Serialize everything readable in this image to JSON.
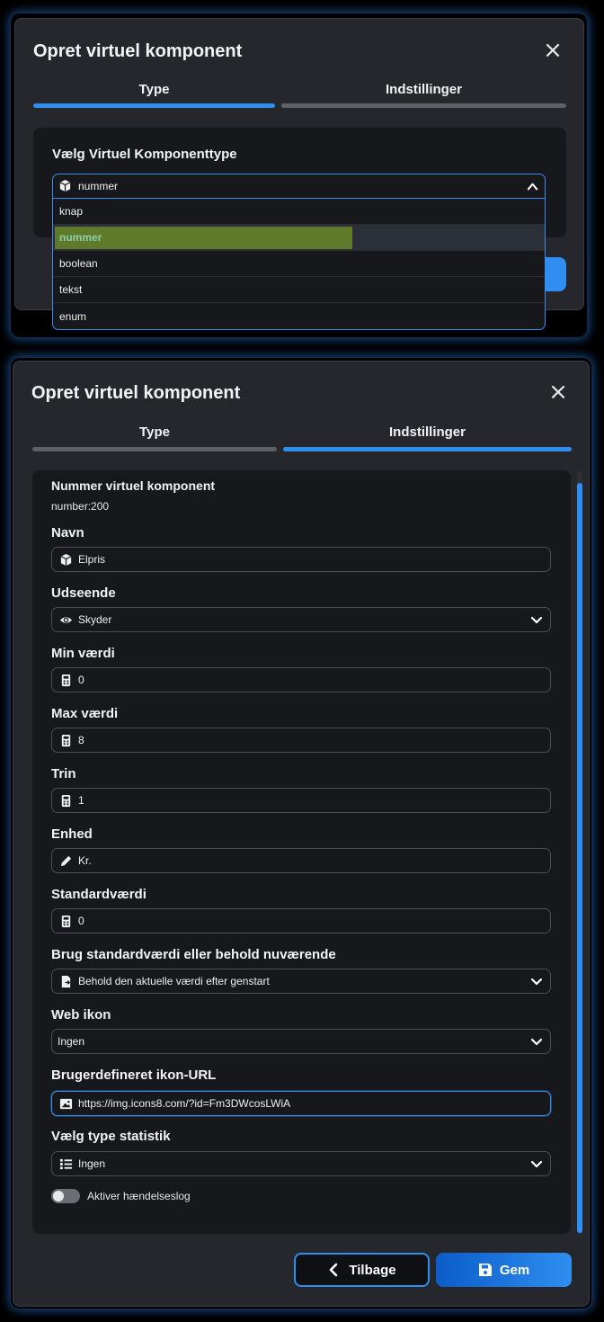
{
  "top_modal": {
    "title": "Opret virtuel komponent",
    "tabs": [
      {
        "label": "Type",
        "active": true
      },
      {
        "label": "Indstillinger",
        "active": false
      }
    ],
    "section_label": "Vælg Virtuel Komponenttype",
    "dropdown": {
      "selected": "nummer",
      "icon": "cube-icon",
      "options": [
        "knap",
        "nummer",
        "boolean",
        "tekst",
        "enum"
      ]
    }
  },
  "bottom_modal": {
    "title": "Opret virtuel komponent",
    "tabs": [
      {
        "label": "Type",
        "active": false
      },
      {
        "label": "Indstillinger",
        "active": true
      }
    ],
    "heading": "Nummer virtuel komponent",
    "identifier": "number:200",
    "fields": {
      "navn": {
        "label": "Navn",
        "value": "Elpris",
        "icon": "cube-icon"
      },
      "udseende": {
        "label": "Udseende",
        "value": "Skyder",
        "icon": "eye-icon"
      },
      "min": {
        "label": "Min værdi",
        "value": "0",
        "icon": "calculator-icon"
      },
      "max": {
        "label": "Max værdi",
        "value": "8",
        "icon": "calculator-icon"
      },
      "trin": {
        "label": "Trin",
        "value": "1",
        "icon": "calculator-icon"
      },
      "enhed": {
        "label": "Enhed",
        "value": "Kr.",
        "icon": "pencil-icon"
      },
      "standard": {
        "label": "Standardværdi",
        "value": "0",
        "icon": "calculator-icon"
      },
      "brug": {
        "label": "Brug standardværdi eller behold nuværende",
        "value": "Behold den aktuelle værdi efter genstart",
        "icon": "file-arrow-icon"
      },
      "webikon": {
        "label": "Web ikon",
        "value": "Ingen"
      },
      "ikonurl": {
        "label": "Brugerdefineret ikon-URL",
        "value": "https://img.icons8.com/?id=Fm3DWcosLWiA",
        "icon": "image-icon"
      },
      "statistik": {
        "label": "Vælg type statistik",
        "value": "Ingen",
        "icon": "list-icon"
      }
    },
    "toggle": {
      "label": "Aktiver hændelseslog",
      "on": false
    },
    "buttons": {
      "back": "Tilbage",
      "save": "Gem"
    }
  },
  "colors": {
    "accent": "#2f8ef0",
    "highlight": "#5f7a2a",
    "panel": "#17181b",
    "modal": "#25272c"
  }
}
